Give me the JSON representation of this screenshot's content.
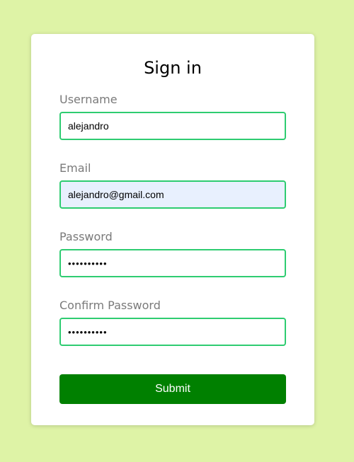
{
  "form": {
    "title": "Sign in",
    "username": {
      "label": "Username",
      "value": "alejandro"
    },
    "email": {
      "label": "Email",
      "value": "alejandro@gmail.com"
    },
    "password": {
      "label": "Password",
      "value": "••••••••••"
    },
    "confirm_password": {
      "label": "Confirm Password",
      "value": "••••••••••"
    },
    "submit_label": "Submit"
  },
  "colors": {
    "page_background": "#def3a6",
    "card_background": "#ffffff",
    "input_border": "#2ecc71",
    "autofill_background": "#e8f0fe",
    "submit_background": "#008000",
    "label_text": "#7a7a7a"
  }
}
